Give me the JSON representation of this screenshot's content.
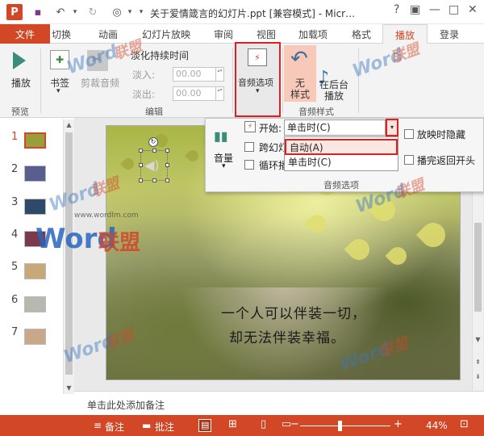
{
  "titlebar": {
    "logo_letter": "P",
    "title": "关于爱情箴言的幻灯片.ppt [兼容模式] - Micr…",
    "icons": [
      "save-icon",
      "undo-icon",
      "redo-icon",
      "touch-mode-icon",
      "customize-icon"
    ],
    "glyph_save": "▪",
    "glyph_undo": "↶",
    "glyph_undo_drop": "▾",
    "glyph_redo": "↻",
    "glyph_touch": "◎",
    "glyph_touch_drop": "▾",
    "glyph_customize": "▾",
    "glyph_help": "?",
    "glyph_restore": "▣",
    "glyph_min": "—",
    "glyph_max": "□",
    "glyph_close": "✕"
  },
  "tabs": {
    "file": "文件",
    "items": [
      "切换",
      "动画",
      "幻灯片放映",
      "审阅",
      "视图",
      "加载项",
      "格式"
    ],
    "active": "播放",
    "login": "登录"
  },
  "ribbon": {
    "play_label": "播放",
    "bookmark_label": "书签",
    "trim_label": "剪裁音频",
    "fade_title": "淡化持续时间",
    "fade_in_label": "淡入:",
    "fade_in_value": "00.00",
    "fade_out_label": "淡出:",
    "fade_out_value": "00.00",
    "audio_options_label": "音频选项",
    "no_style_label_1": "无",
    "no_style_label_2": "样式",
    "bg_play_label_1": "在后台",
    "bg_play_label_2": "播放",
    "group_preview": "预览",
    "group_edit": "编辑",
    "group_audio_style": "音频样式",
    "glyph_dropdown": "▾",
    "glyph_bookmark": "✚",
    "glyph_trim": "✂",
    "glyph_audio_opt": "⚡",
    "glyph_no_style": "↶",
    "glyph_bg_play": "♪",
    "glyph_spin": "▴▾"
  },
  "thumbnails": {
    "numbers": [
      "1",
      "2",
      "3",
      "4",
      "5",
      "6",
      "7"
    ],
    "active_index": 0,
    "colors": [
      "#9a9e3a",
      "#5a5e8e",
      "#2e4a6a",
      "#7a3a4a",
      "#c8a878",
      "#b8b8b0",
      "#c8a888"
    ]
  },
  "panel": {
    "volume_label": "音量",
    "start_label": "开始:",
    "start_value": "单击时(C)",
    "options": [
      "自动(A)",
      "单击时(C)"
    ],
    "cross_slides_label": "跨幻灯",
    "loop_label": "循环播",
    "hide_label": "放映时隐藏",
    "rewind_label": "播完返回开头",
    "group_label": "音频选项",
    "glyph_volume": "▮▮",
    "glyph_arrow": "▾"
  },
  "slide": {
    "line1": "一个人可以伴装一切，",
    "line2": "却无法伴装幸福。",
    "glyph_speaker": "◀)",
    "glyph_rotate": "↻"
  },
  "notes": {
    "placeholder": "单击此处添加备注"
  },
  "statusbar": {
    "notes_label": "备注",
    "comments_label": "批注",
    "zoom": "44%",
    "glyph_notes": "≡",
    "glyph_comments": "▬",
    "glyph_minus": "−",
    "glyph_plus": "+",
    "glyph_fit": "⊡",
    "glyph_view_normal": "▤",
    "glyph_view_sorter": "⊞",
    "glyph_view_reading": "▯",
    "glyph_view_slideshow": "▭"
  },
  "scroll": {
    "up": "▲",
    "down": "▼",
    "prev": "⇞",
    "next": "⇟"
  },
  "watermark": {
    "word": "Word",
    "union": "联盟",
    "site": "www.wordlm.com"
  }
}
